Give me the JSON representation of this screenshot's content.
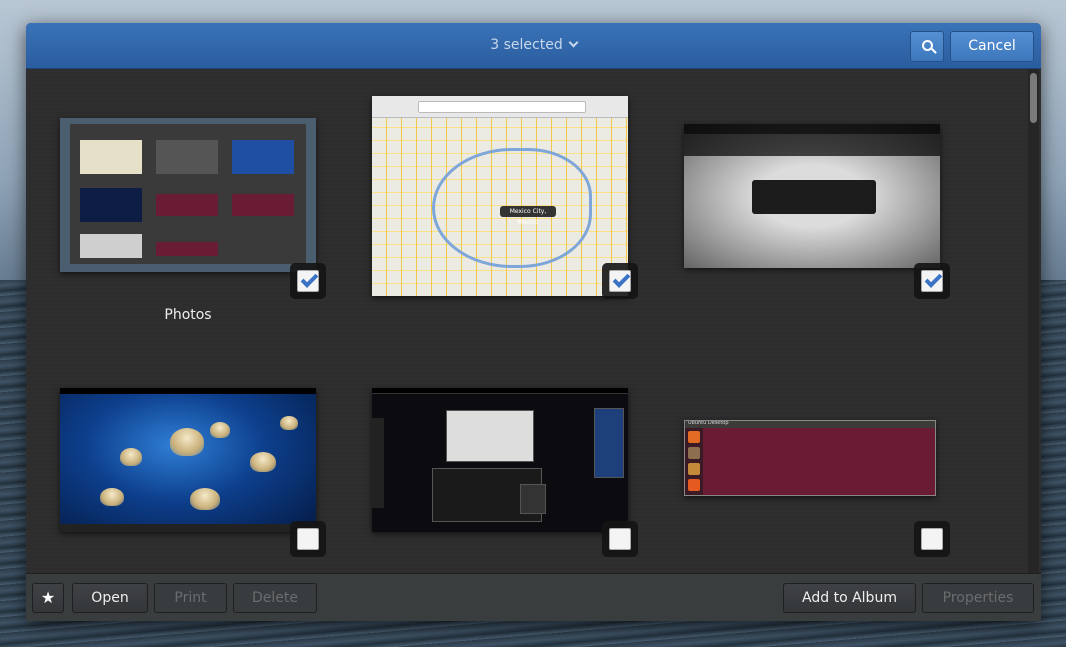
{
  "header": {
    "selection_label": "3 selected",
    "cancel_label": "Cancel"
  },
  "collection": {
    "label": "Photos"
  },
  "items": [
    {
      "kind": "collection",
      "selected": true
    },
    {
      "kind": "map-screenshot",
      "selected": true,
      "map_label": "Mexico City, Mexico"
    },
    {
      "kind": "extensions-screenshot",
      "selected": true
    },
    {
      "kind": "jellyfish-desktop",
      "selected": false
    },
    {
      "kind": "activities-overview",
      "selected": false
    },
    {
      "kind": "ubuntu-desktop",
      "selected": false,
      "window_title": "Ubuntu Desktop"
    }
  ],
  "actionbar": {
    "open_label": "Open",
    "print_label": "Print",
    "delete_label": "Delete",
    "add_to_album_label": "Add to Album",
    "properties_label": "Properties"
  },
  "icons": {
    "star": "star-icon",
    "search": "search-icon",
    "dropdown": "chevron-down-icon"
  },
  "colors": {
    "accent": "#2a5d9f",
    "check": "#3b73c4"
  }
}
